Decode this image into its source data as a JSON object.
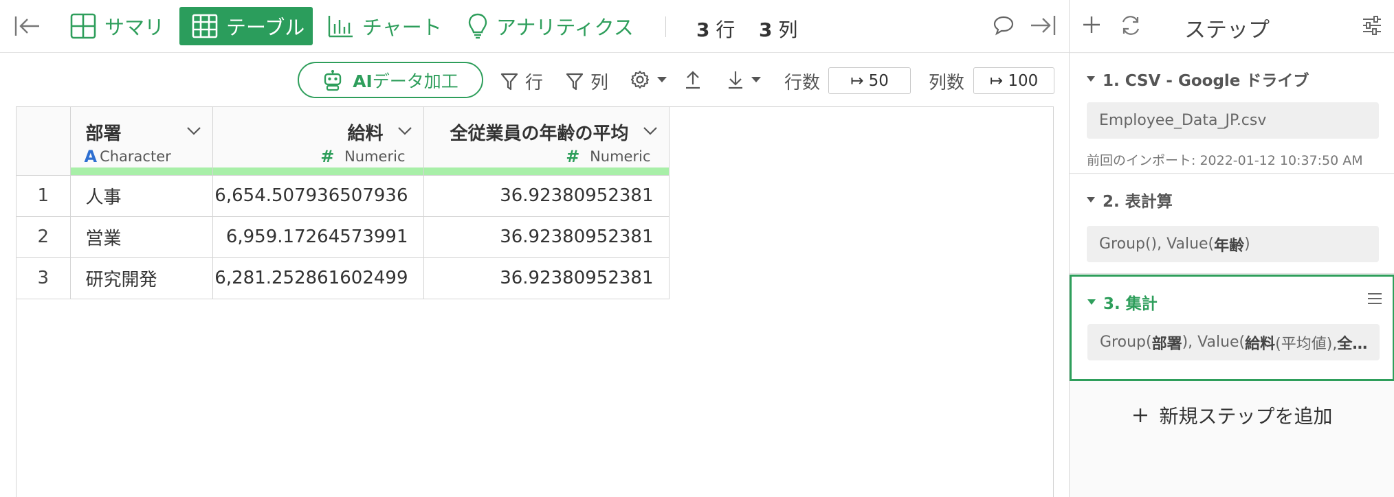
{
  "toolbar": {
    "tabs": [
      {
        "label": "サマリ",
        "icon": "grid-icon"
      },
      {
        "label": "テーブル",
        "icon": "table-icon",
        "active": true
      },
      {
        "label": "チャート",
        "icon": "bar-chart-icon"
      },
      {
        "label": "アナリティクス",
        "icon": "lightbulb-icon"
      }
    ],
    "row_count": "3",
    "row_unit": "行",
    "col_count": "3",
    "col_unit": "列"
  },
  "subbar": {
    "ai_label_bold": "AI",
    "ai_label": "データ加工",
    "filter_row": "行",
    "filter_col": "列",
    "rows_label": "行数",
    "rows_value": "↦ 50",
    "cols_label": "列数",
    "cols_value": "↦ 100"
  },
  "table": {
    "columns": [
      {
        "name": "部署",
        "type": "Character",
        "type_glyph": "A"
      },
      {
        "name": "給料",
        "type": "Numeric",
        "type_glyph": "#"
      },
      {
        "name": "全従業員の年齢の平均",
        "type": "Numeric",
        "type_glyph": "#"
      }
    ],
    "rows": [
      {
        "index": "1",
        "cells": [
          "人事",
          "6,654.507936507936",
          "36.92380952381"
        ]
      },
      {
        "index": "2",
        "cells": [
          "営業",
          "6,959.17264573991",
          "36.92380952381"
        ]
      },
      {
        "index": "3",
        "cells": [
          "研究開発",
          "6,281.252861602499",
          "36.92380952381"
        ]
      }
    ]
  },
  "steps_panel": {
    "title": "ステップ",
    "steps": [
      {
        "title": "1. CSV - Google ドライブ",
        "body": "Employee_Data_JP.csv",
        "meta": "前回のインポート: 2022-01-12 10:37:50 AM"
      },
      {
        "title": "2. 表計算",
        "body_pre": "Group(), Value(",
        "body_bold": "年齢",
        "body_post": ")"
      },
      {
        "title": "3. 集計",
        "body_pre": "Group(",
        "body_bold1": "部署",
        "body_mid1": "), Value(",
        "body_bold2": "給料",
        "body_mid2": " (平均値),",
        "body_bold3": "全…"
      }
    ],
    "add_step": "新規ステップを追加"
  },
  "colors": {
    "accent": "#2e9e5b",
    "header_bar": "#a8efa8",
    "char_type": "#2e6fd1"
  }
}
